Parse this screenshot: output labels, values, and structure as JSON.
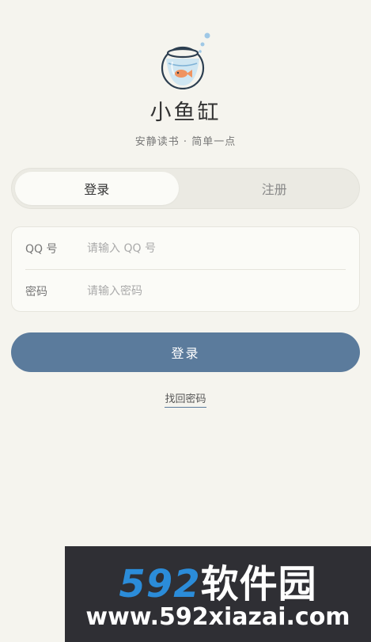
{
  "app": {
    "logo_icon": "fishbowl-icon",
    "title": "小鱼缸",
    "subtitle": "安静读书 · 简单一点"
  },
  "tabs": [
    {
      "label": "登录",
      "active": true
    },
    {
      "label": "注册",
      "active": false
    }
  ],
  "form": {
    "qq_label": "QQ 号",
    "qq_placeholder": "请输入 QQ 号",
    "qq_value": "",
    "password_label": "密码",
    "password_placeholder": "请输入密码",
    "password_value": ""
  },
  "submit_label": "登录",
  "find_password_label": "找回密码",
  "colors": {
    "background": "#f5f4ee",
    "primary": "#5b7b9c",
    "fish": "#f0935f",
    "bowl_water": "#cfe6f2"
  },
  "watermark": {
    "brand_number": "592",
    "brand_text": "软件园",
    "url": "www.592xiazai.com"
  }
}
